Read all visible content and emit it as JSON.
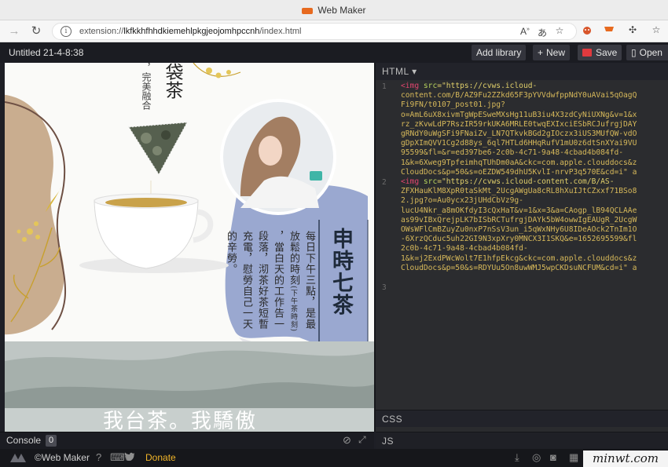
{
  "window": {
    "title": "Web Maker"
  },
  "browser": {
    "url_prefix": "extension://",
    "url_host": "lkfkkhfhhdkiemehlpkgjeojomhpccnh",
    "url_path": "/index.html"
  },
  "app": {
    "project_title": "Untitled 21-4-8:38",
    "add_library": "Add library",
    "new_label": "New",
    "save_label": "Save",
    "open_label": "Open"
  },
  "editor": {
    "html_tab": "HTML",
    "css_tab": "CSS",
    "js_tab": "JS",
    "line_numbers": [
      "1",
      "2",
      "3"
    ],
    "code_lines": [
      "<img src=\"https://cvws.icloud-",
      "content.com/B/AZ9Fu2ZZkd65F3pYVVdwfppNdY0uAVai5qOagQ",
      "Fi9FN/t0107_post01.jpg?",
      "o=AmL6uX8xivmTgWpESweMXsHg11uB3iu4X3zdCyNiUXNg&v=1&x",
      "rz_zKvwLdP7RszIR59rkUKA6MRLE0twqEXIxciESbRCJufrgjDAY",
      "gRNdY0uWgSFi9FNaiZv_LN7QTkvkBGd2gIOczx3iUS3MUfQW-vdO",
      "gDpXImQVV1Cg2d88ys_6ql7HTLd6HHqRufV1mU0z6dtSnXYai9VU",
      "95599&fl=&r=ed397be6-2c0b-4c71-9a48-4cbad4b084fd-",
      "1&k=6Xweg9TpfeimhqTUhDm0aA&ckc=com.apple.clouddocs&z",
      "CloudDocs&p=50&s=oEZDW549dhU5KvlI-nrvP3q570E&cd=i\" a",
      "<img src=\"https://cvws.icloud-content.com/B/AS-",
      "ZFXHauKlM8XpR0taSkMt_2UcgAWgUa8cRL8hXuIJtCZxxf71BSo8",
      "2.jpg?o=Au0ycx23jUHdCbVz9g-",
      "lucU4Nkr_a8mOKfdyI3cQxHaT&v=1&x=3&a=CAogp_lB94QCLAAe",
      "as99vIBxQrejpLK7bISbRCTufrgjDAYk5bW4owwIgEAUgR_2UcgW",
      "OWsWFlCmBZuyZu0nxP7nSsV3un_i5qWxNHy6U8IDeAOck2TnIm1O",
      "-6XrzQCduc5uh22GI9N3xpXry0MNCX3I1SKQ&e=1652695599&fl",
      "2c0b-4c71-9a48-4cbad4b084fd-",
      "1&k=j2ExdPWcWolt7E1hfpEkcg&ckc=com.apple.clouddocs&z",
      "CloudDocs&p=50&s=RDYUu5On8uwWMJ5wpCKDsuNCFUM&cd=i\" a"
    ]
  },
  "console": {
    "label": "Console",
    "count": "0"
  },
  "footer": {
    "brand": "©Web Maker",
    "donate": "Donate"
  },
  "watermark": {
    "text": "minwt.com"
  },
  "poster": {
    "top_col1": "袋茶",
    "top_col2": "，完美融合",
    "title": "申時七茶",
    "col1": "每日下午三點，是最",
    "col2": "放鬆的時刻",
    "col2_note": "(下午茶時刻)",
    "col3": "，當白天的工作告一",
    "col4": "段落，沏茶好茶短暫",
    "col5": "充電，慰勞自己一天",
    "col6": "的辛勞。",
    "banner": "我台茶。我驕傲"
  },
  "colors": {
    "accent_red": "#e03a3e",
    "donate": "#f0b429",
    "tag": "#e0456e",
    "attr": "#b7d35c"
  }
}
